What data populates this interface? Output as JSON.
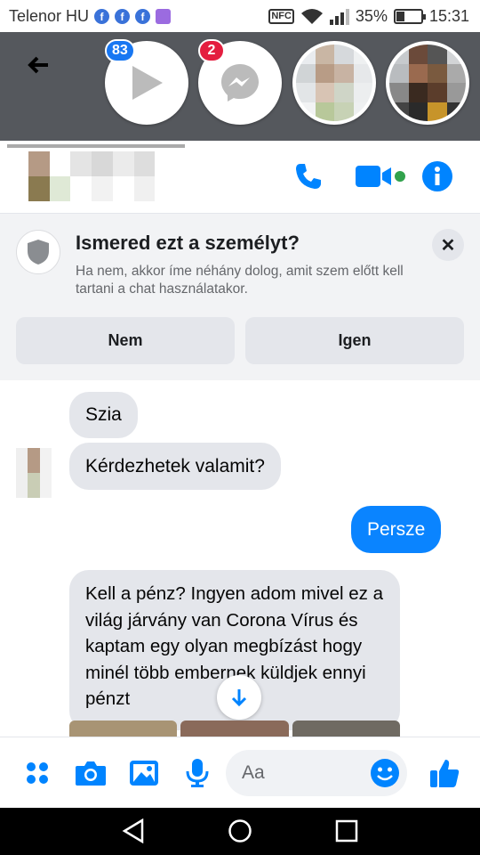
{
  "status_bar": {
    "carrier": "Telenor HU",
    "fb_icon_letter": "f",
    "nfc_label": "NFC",
    "battery_percent": "35%",
    "battery_level": 0.35,
    "time": "15:31"
  },
  "chat_heads": {
    "video_badge": "83",
    "messenger_badge": "2",
    "colors": {
      "video_badge": "#1877f2",
      "messenger_badge": "#e41e3f"
    }
  },
  "notice": {
    "title": "Ismered ezt a személyt?",
    "subtitle": "Ha nem, akkor íme néhány dolog, amit szem előtt kell tartani a chat használatakor.",
    "close_glyph": "✕",
    "no_label": "Nem",
    "yes_label": "Igen"
  },
  "messages": [
    {
      "from": "them",
      "text": "Szia"
    },
    {
      "from": "them",
      "text": "Kérdezhetek valamit?"
    },
    {
      "from": "me",
      "text": "Persze"
    },
    {
      "from": "them",
      "text": "Kell a pénz? Ingyen adom mivel ez a világ járvány van Corona Vírus és kaptam egy olyan megbízást hogy minél több embernek küldjek ennyi pénzt"
    }
  ],
  "composer": {
    "placeholder": "Aa"
  },
  "colors": {
    "accent": "#0a84ff",
    "icon_blue": "#0084ff",
    "online_green": "#31a24c"
  },
  "icons": [
    "back-arrow-icon",
    "play-icon",
    "messenger-icon",
    "phone-icon",
    "video-camera-icon",
    "info-icon",
    "shield-icon",
    "close-icon",
    "arrow-down-icon",
    "apps-grid-icon",
    "camera-icon",
    "gallery-icon",
    "microphone-icon",
    "emoji-icon",
    "thumbs-up-icon",
    "nav-back-icon",
    "nav-home-icon",
    "nav-recents-icon"
  ]
}
